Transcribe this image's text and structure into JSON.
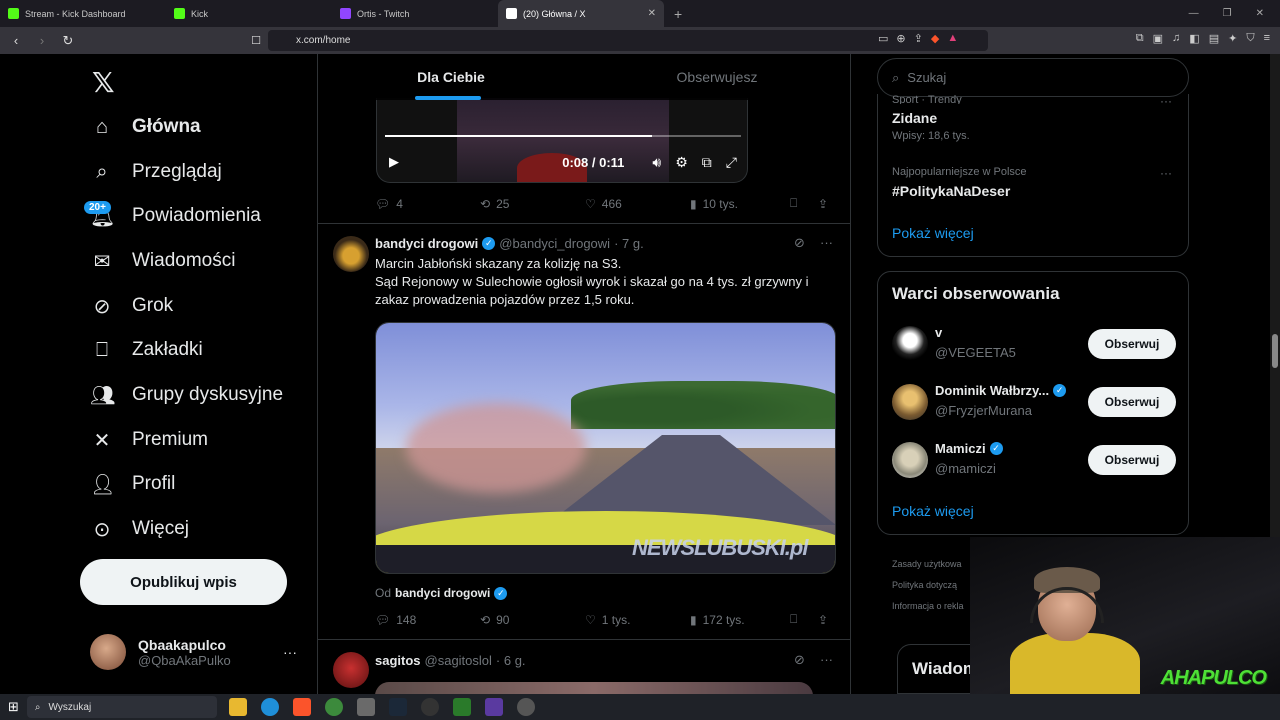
{
  "browser": {
    "tabs": [
      {
        "title": "Stream - Kick Dashboard",
        "color": "#53fc18"
      },
      {
        "title": "Kick",
        "color": "#53fc18"
      },
      {
        "title": "Ortis - Twitch",
        "color": "#9146ff"
      },
      {
        "title": "(20) Główna / X",
        "color": "#ffffff"
      }
    ],
    "url": "x.com/home"
  },
  "nav": {
    "items": [
      {
        "label": "Główna",
        "icon": "home-icon"
      },
      {
        "label": "Przeglądaj",
        "icon": "search-icon"
      },
      {
        "label": "Powiadomienia",
        "icon": "bell-icon"
      },
      {
        "label": "Wiadomości",
        "icon": "mail-icon"
      },
      {
        "label": "Grok",
        "icon": "grok-icon"
      },
      {
        "label": "Zakładki",
        "icon": "bookmark-icon"
      },
      {
        "label": "Grupy dyskusyjne",
        "icon": "people-icon"
      },
      {
        "label": "Premium",
        "icon": "x-icon"
      },
      {
        "label": "Profil",
        "icon": "user-icon"
      },
      {
        "label": "Więcej",
        "icon": "more-icon"
      }
    ],
    "notifications_badge": "20+",
    "post_button": "Opublikuj wpis",
    "account": {
      "name": "Qbaakapulco",
      "handle": "@QbaAkaPulko"
    }
  },
  "feed": {
    "tabs": [
      "Dla Ciebie",
      "Obserwujesz"
    ],
    "video1": {
      "time": "0:08 / 0:11",
      "progress": 0.75
    },
    "tweet1_actions": {
      "replies": "4",
      "reposts": "25",
      "likes": "466",
      "views": "10 tys."
    },
    "tweet2": {
      "name": "bandyci drogowi",
      "handle": "@bandyci_drogowi",
      "time": "· 7 g.",
      "line1": "Marcin Jabłoński skazany za kolizję na S3.",
      "line2": "Sąd Rejonowy w Sulechowie ogłosił wyrok i skazał go na 4 tys. zł grzywny i zakaz prowadzenia pojazdów przez 1,5 roku.",
      "watermark": "NEWSLUBUSKI.pl",
      "from_label": "Od",
      "from_name": "bandyci drogowi",
      "actions": {
        "replies": "148",
        "reposts": "90",
        "likes": "1 tys.",
        "views": "172 tys."
      }
    },
    "tweet3": {
      "name": "sagitos",
      "handle": "@sagitoslol",
      "time": "· 6 g."
    }
  },
  "sidebar": {
    "search_placeholder": "Szukaj",
    "trends": [
      {
        "meta": "Sport · Trendy",
        "name": "Zidane",
        "count": "Wpisy: 18,6 tys."
      },
      {
        "meta": "Najpopularniejsze w Polsce",
        "name": "#PolitykaNaDeser"
      }
    ],
    "trends_more": "Pokaż więcej",
    "follow_title": "Warci obserwowania",
    "follow": [
      {
        "name": "v",
        "handle": "@VEGEETA5",
        "verified": false
      },
      {
        "name": "Dominik Wałbrzy...",
        "handle": "@FryzjerMurana",
        "verified": true
      },
      {
        "name": "Mamiczi",
        "handle": "@mamiczi",
        "verified": true
      }
    ],
    "follow_button": "Obserwuj",
    "follow_more": "Pokaż więcej",
    "footer": [
      "Zasady użytkowa",
      "Polityka dotyczą",
      "Informacja o rekla"
    ],
    "messages_label": "Wiadom"
  },
  "overlay": {
    "tag": "AHAPULCO"
  },
  "taskbar": {
    "search": "Wyszukaj"
  }
}
